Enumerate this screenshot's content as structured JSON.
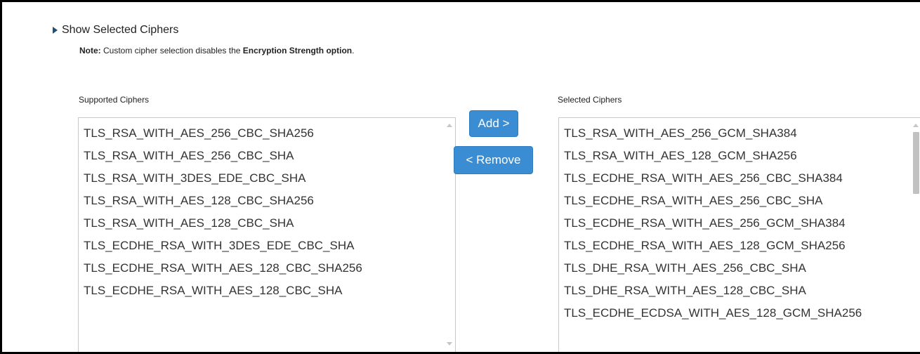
{
  "toggle": {
    "label": "Show Selected Ciphers"
  },
  "note": {
    "prefix": "Note:",
    "text_before": " Custom cipher selection disables the ",
    "emphasis": "Encryption Strength option",
    "text_after": "."
  },
  "supported": {
    "label": "Supported Ciphers",
    "items": [
      "TLS_RSA_WITH_AES_256_CBC_SHA256",
      "TLS_RSA_WITH_AES_256_CBC_SHA",
      "TLS_RSA_WITH_3DES_EDE_CBC_SHA",
      "TLS_RSA_WITH_AES_128_CBC_SHA256",
      "TLS_RSA_WITH_AES_128_CBC_SHA",
      "TLS_ECDHE_RSA_WITH_3DES_EDE_CBC_SHA",
      "TLS_ECDHE_RSA_WITH_AES_128_CBC_SHA256",
      "TLS_ECDHE_RSA_WITH_AES_128_CBC_SHA"
    ]
  },
  "selected": {
    "label": "Selected Ciphers",
    "items": [
      "TLS_RSA_WITH_AES_256_GCM_SHA384",
      "TLS_RSA_WITH_AES_128_GCM_SHA256",
      "TLS_ECDHE_RSA_WITH_AES_256_CBC_SHA384",
      "TLS_ECDHE_RSA_WITH_AES_256_CBC_SHA",
      "TLS_ECDHE_RSA_WITH_AES_256_GCM_SHA384",
      "TLS_ECDHE_RSA_WITH_AES_128_GCM_SHA256",
      "TLS_DHE_RSA_WITH_AES_256_CBC_SHA",
      "TLS_DHE_RSA_WITH_AES_128_CBC_SHA",
      "TLS_ECDHE_ECDSA_WITH_AES_128_GCM_SHA256"
    ]
  },
  "buttons": {
    "add": "Add >",
    "remove": "< Remove"
  },
  "colors": {
    "button_bg": "#3a8dd3",
    "toggle_arrow": "#1f4e79",
    "list_border": "#c9c9c9"
  }
}
